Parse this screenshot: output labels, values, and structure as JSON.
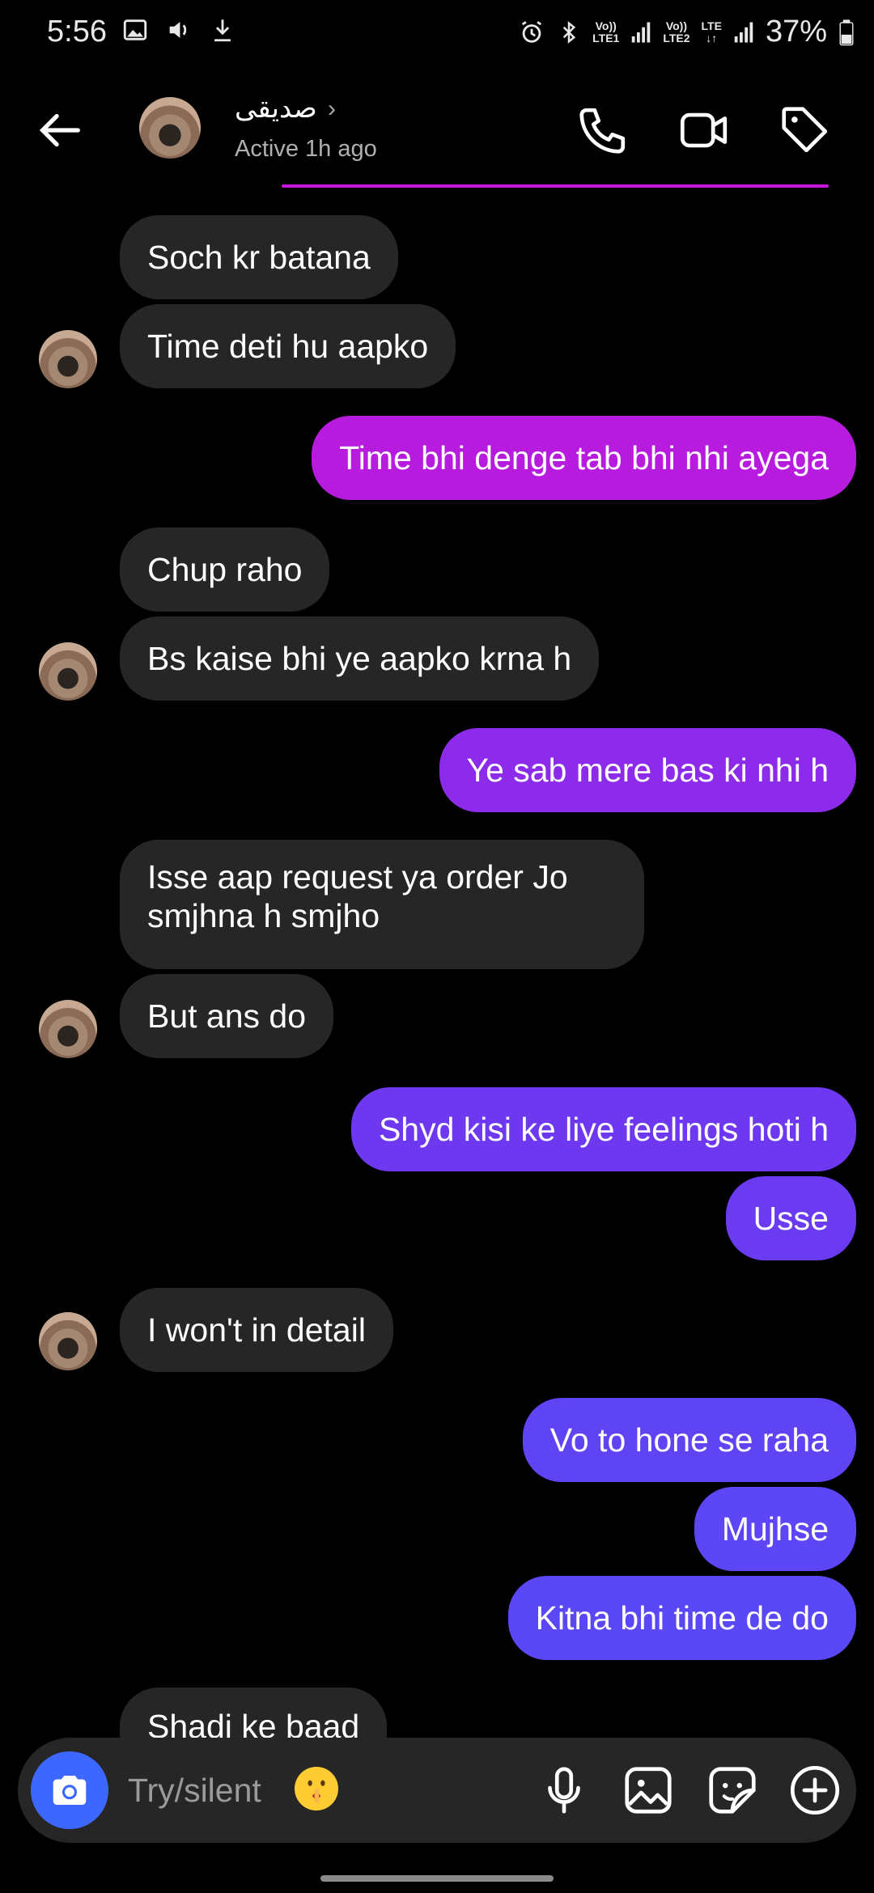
{
  "status_bar": {
    "time": "5:56",
    "battery": "37%",
    "net1_top": "Vo))",
    "net1_bottom": "LTE1",
    "net2_top": "Vo))",
    "net2_bottom": "LTE2",
    "net3_top": "LTE",
    "net3_bottom": "↓↑"
  },
  "header": {
    "contact_name": "صديقى",
    "active_status": "Active 1h ago"
  },
  "messages": [
    {
      "text": "Soch kr batana"
    },
    {
      "text": "Time deti hu aapko"
    },
    {
      "text": "Time bhi denge tab bhi nhi ayega"
    },
    {
      "text": "Chup raho"
    },
    {
      "text": "Bs kaise bhi ye aapko krna h"
    },
    {
      "text": "Ye sab mere bas ki nhi h"
    },
    {
      "text": "Isse aap request ya order Jo smjhna h smjho"
    },
    {
      "text": "But ans do"
    },
    {
      "text": "Shyd kisi ke liye feelings hoti h"
    },
    {
      "text": "Usse"
    },
    {
      "text": "I won't in detail"
    },
    {
      "text": "Vo to hone se raha"
    },
    {
      "text": "Mujhse"
    },
    {
      "text": "Kitna bhi time de do"
    },
    {
      "text": "Shadi ke baad"
    }
  ],
  "composer": {
    "placeholder": "Try/silent"
  },
  "colors": {
    "received_bubble": "#262626",
    "sent_pink": "#b61bde",
    "sent_purple": "#8d2bea",
    "sent_indigo": "#6b3bf2",
    "camera_blue": "#3d68ff"
  }
}
